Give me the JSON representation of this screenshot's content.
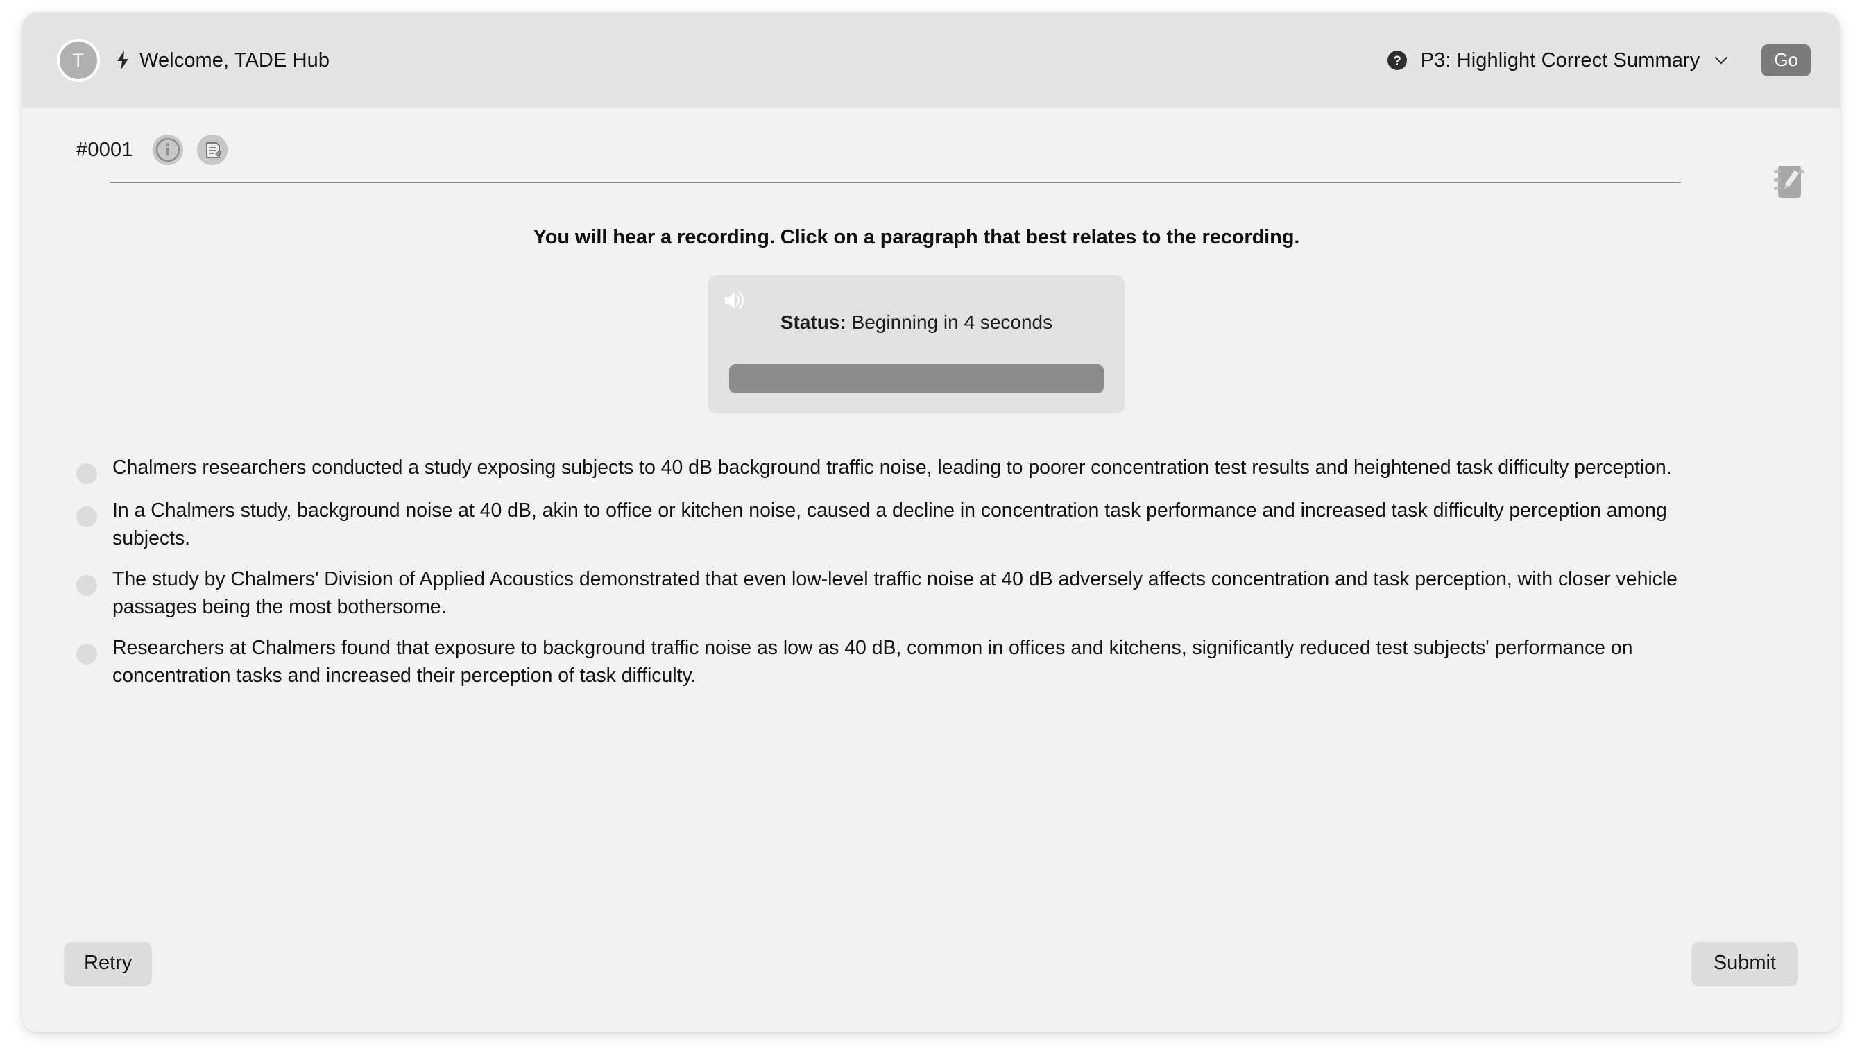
{
  "header": {
    "avatar_initial": "T",
    "bolt_icon": "lightning-bolt-icon",
    "welcome_text": "Welcome, TADE Hub",
    "help_icon": "question-mark-circle-icon",
    "task_label": "P3: Highlight Correct Summary",
    "chevron_icon": "chevron-down-icon",
    "go_label": "Go"
  },
  "task": {
    "id": "#0001",
    "info_icon": "info-circle-icon",
    "notes_icon": "document-edit-icon",
    "notebook_icon": "notebook-pencil-icon"
  },
  "prompt": "You will hear a recording. Click on a paragraph that best relates to the recording.",
  "audio": {
    "speaker_icon": "speaker-wave-icon",
    "status_label": "Status:",
    "status_value": "Beginning in 4 seconds",
    "progress_percent": 100
  },
  "options": [
    {
      "text": "Chalmers researchers conducted a study exposing subjects to 40 dB background traffic noise, leading to poorer concentration test results and heightened task difficulty perception."
    },
    {
      "text": "In a Chalmers study, background noise at 40 dB, akin to office or kitchen noise, caused a decline in concentration task performance and increased task difficulty perception among subjects."
    },
    {
      "text": "The study by Chalmers' Division of Applied Acoustics demonstrated that even low-level traffic noise at 40 dB adversely affects concentration and task perception, with closer vehicle passages being the most bothersome."
    },
    {
      "text": "Researchers at Chalmers found that exposure to background traffic noise as low as 40 dB, common in offices and kitchens, significantly reduced test subjects' performance on concentration tasks and increased their perception of task difficulty."
    }
  ],
  "footer": {
    "retry_label": "Retry",
    "submit_label": "Submit"
  },
  "colors": {
    "header_bg": "#e4e4e4",
    "page_bg": "#f2f2f2",
    "accent_gray": "#7b7b7b",
    "progress_fill": "#8b8b8b",
    "button_bg": "#dcdcdc"
  }
}
